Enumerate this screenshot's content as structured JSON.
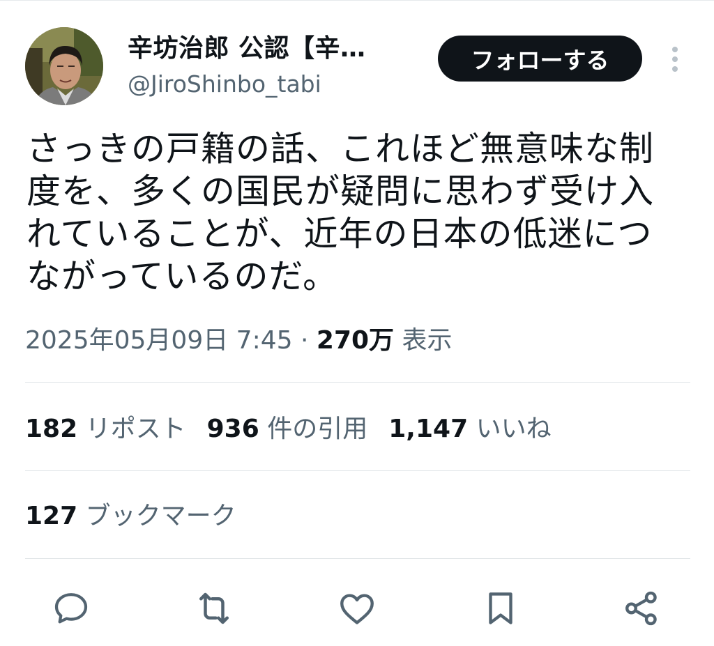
{
  "author": {
    "display_name": "辛坊治郎 公認【辛…",
    "handle": "@JiroShinbo_tabi",
    "avatar_icon": "profile-photo"
  },
  "follow_button": {
    "label": "フォローする"
  },
  "more_icon": "more-vertical-icon",
  "tweet": {
    "text": "さっきの戸籍の話、これほど無意味な制度を、多くの国民が疑問に思わず受け入れていることが、近年の日本の低迷につながっているのだ。"
  },
  "meta": {
    "timestamp": "2025年05月09日 7:45",
    "separator": "·",
    "views_count": "270万",
    "views_label": "表示"
  },
  "stats": {
    "reposts_count": "182",
    "reposts_label": "リポスト",
    "quotes_count": "936",
    "quotes_label": "件の引用",
    "likes_count": "1,147",
    "likes_label": "いいね",
    "bookmarks_count": "127",
    "bookmarks_label": "ブックマーク"
  },
  "actions": [
    "reply-icon",
    "repost-icon",
    "like-icon",
    "bookmark-icon",
    "share-icon"
  ],
  "colors": {
    "text_primary": "#0f1419",
    "text_secondary": "#536471",
    "follow_bg": "#0f1419",
    "divider": "#e1e5e8"
  }
}
